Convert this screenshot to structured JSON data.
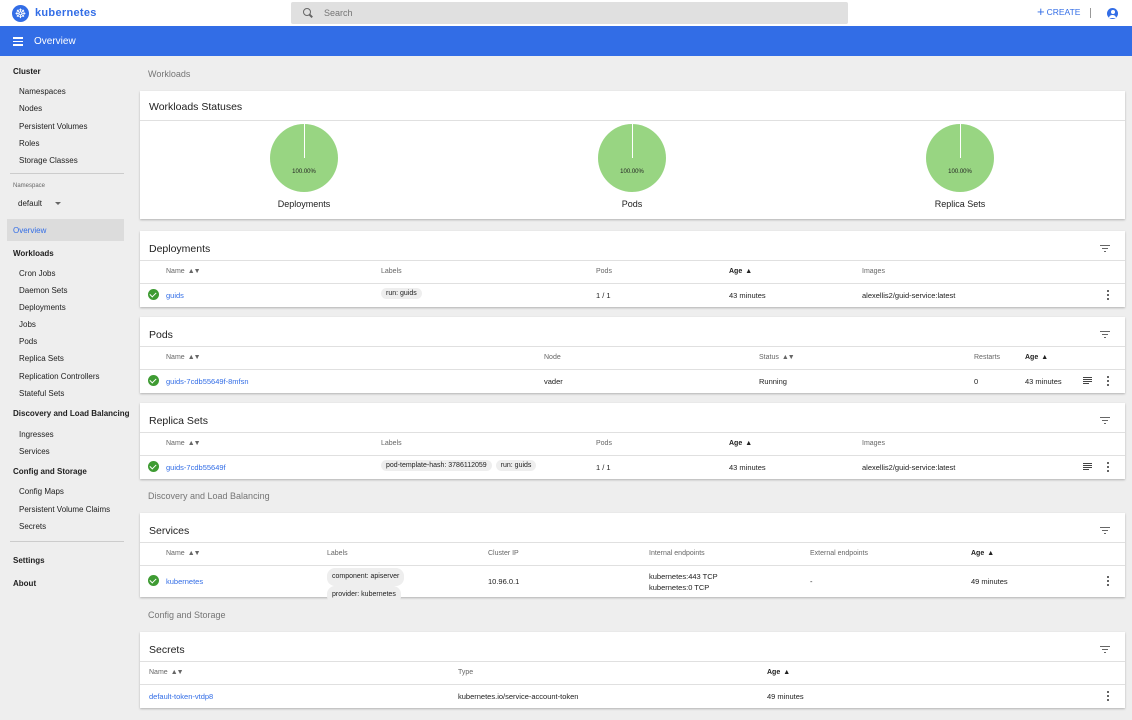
{
  "app": {
    "name": "kubernetes",
    "page_title": "Overview"
  },
  "search": {
    "placeholder": "Search"
  },
  "header": {
    "create_label": "CREATE"
  },
  "sidebar": {
    "cluster": {
      "label": "Cluster",
      "items": [
        "Namespaces",
        "Nodes",
        "Persistent Volumes",
        "Roles",
        "Storage Classes"
      ]
    },
    "namespace": {
      "label": "Namespace",
      "value": "default"
    },
    "overview": "Overview",
    "workloads": {
      "label": "Workloads",
      "items": [
        "Cron Jobs",
        "Daemon Sets",
        "Deployments",
        "Jobs",
        "Pods",
        "Replica Sets",
        "Replication Controllers",
        "Stateful Sets"
      ]
    },
    "discovery": {
      "label": "Discovery and Load Balancing",
      "items": [
        "Ingresses",
        "Services"
      ]
    },
    "config": {
      "label": "Config and Storage",
      "items": [
        "Config Maps",
        "Persistent Volume Claims",
        "Secrets"
      ]
    },
    "settings": "Settings",
    "about": "About"
  },
  "sections": {
    "workloads": "Workloads",
    "discovery": "Discovery and Load Balancing",
    "config": "Config and Storage"
  },
  "statuses": {
    "title": "Workloads Statuses",
    "charts": [
      {
        "label": "Deployments",
        "percent": "100.00%",
        "value": 100
      },
      {
        "label": "Pods",
        "percent": "100.00%",
        "value": 100
      },
      {
        "label": "Replica Sets",
        "percent": "100.00%",
        "value": 100
      }
    ]
  },
  "deployments": {
    "title": "Deployments",
    "headers": [
      "Name",
      "Labels",
      "Pods",
      "Age",
      "Images"
    ],
    "row": {
      "name": "guids",
      "labels": [
        "run: guids"
      ],
      "pods": "1 / 1",
      "age": "43 minutes",
      "images": "alexellis2/guid-service:latest"
    }
  },
  "pods": {
    "title": "Pods",
    "headers": [
      "Name",
      "Node",
      "Status",
      "Restarts",
      "Age"
    ],
    "row": {
      "name": "guids-7cdb55649f-8mfsn",
      "node": "vader",
      "status": "Running",
      "restarts": "0",
      "age": "43 minutes"
    }
  },
  "replicasets": {
    "title": "Replica Sets",
    "headers": [
      "Name",
      "Labels",
      "Pods",
      "Age",
      "Images"
    ],
    "row": {
      "name": "guids-7cdb55649f",
      "labels": [
        "pod-template-hash: 3786112059",
        "run: guids"
      ],
      "pods": "1 / 1",
      "age": "43 minutes",
      "images": "alexellis2/guid-service:latest"
    }
  },
  "services": {
    "title": "Services",
    "headers": [
      "Name",
      "Labels",
      "Cluster IP",
      "Internal endpoints",
      "External endpoints",
      "Age"
    ],
    "row": {
      "name": "kubernetes",
      "labels": [
        "component: apiserver",
        "provider: kubernetes"
      ],
      "cluster_ip": "10.96.0.1",
      "internal": [
        "kubernetes:443 TCP",
        "kubernetes:0 TCP"
      ],
      "external": "-",
      "age": "49 minutes"
    }
  },
  "secrets": {
    "title": "Secrets",
    "headers": [
      "Name",
      "Type",
      "Age"
    ],
    "row": {
      "name": "default-token-vtdp8",
      "type": "kubernetes.io/service-account-token",
      "age": "49 minutes"
    }
  },
  "colors": {
    "primary": "#326de6",
    "success": "#3e9b32",
    "pie": "#98d582"
  }
}
